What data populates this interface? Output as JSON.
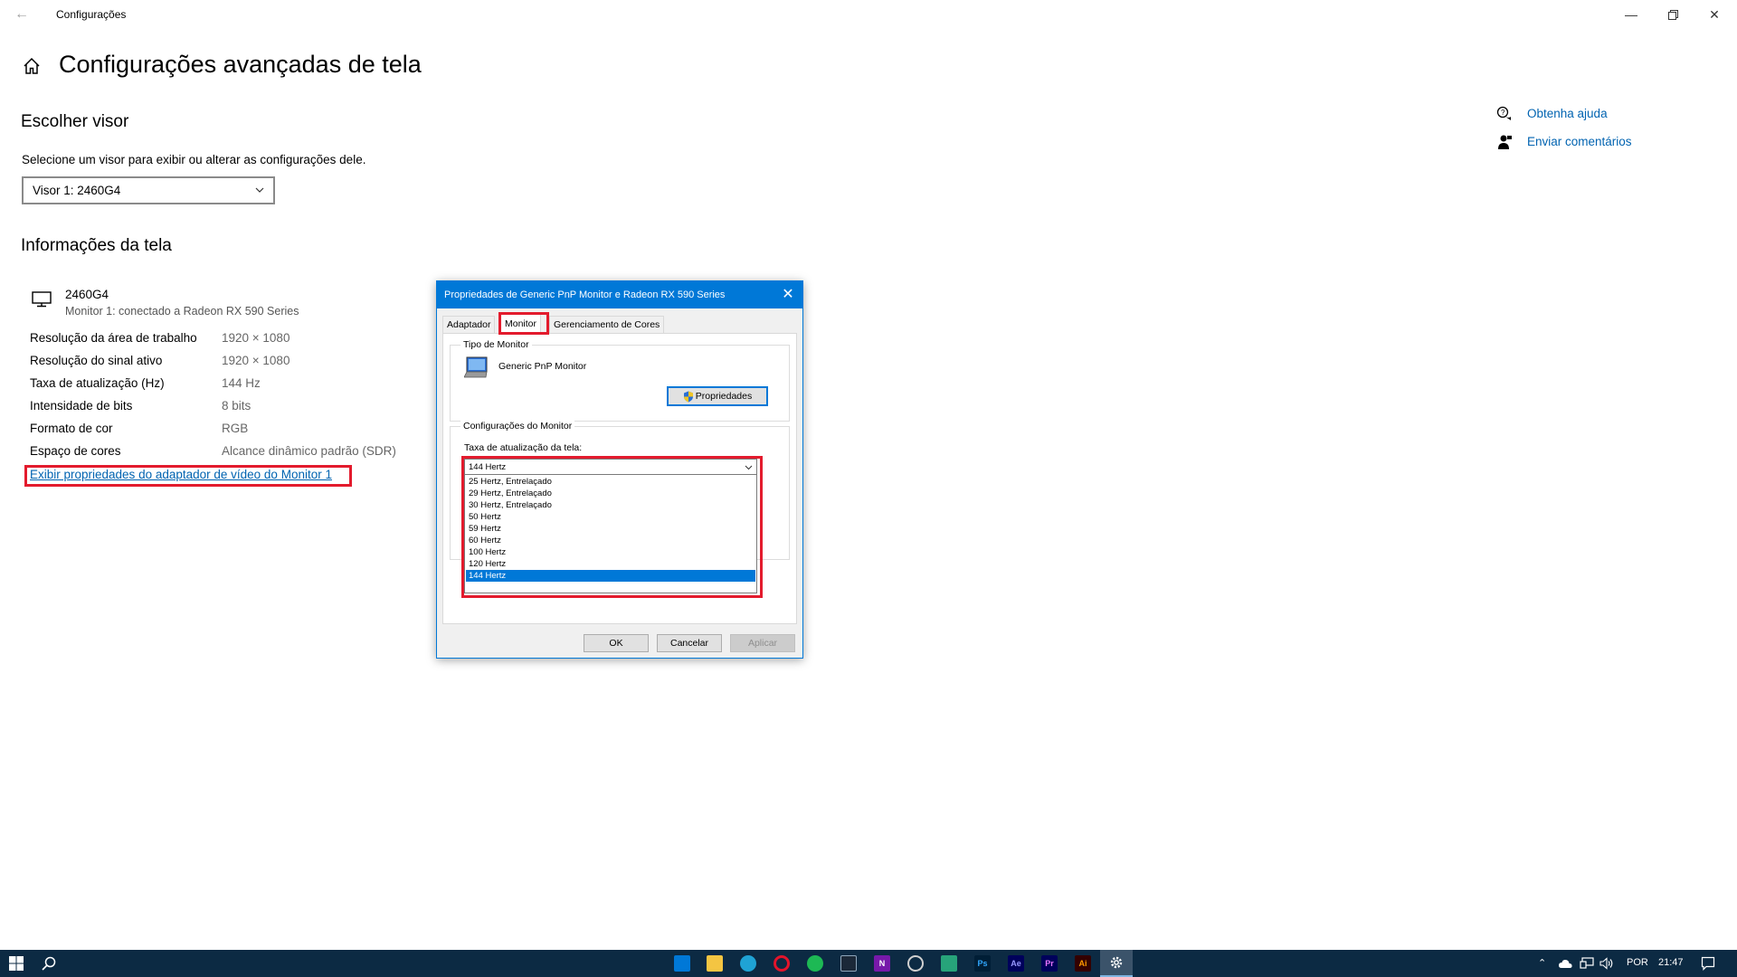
{
  "window": {
    "app_title": "Configurações",
    "page_title": "Configurações avançadas de tela"
  },
  "choose_display": {
    "title": "Escolher visor",
    "description": "Selecione um visor para exibir ou alterar as configurações dele.",
    "selected": "Visor 1: 2460G4"
  },
  "display_info": {
    "title": "Informações da tela",
    "monitor_name": "2460G4",
    "monitor_subtitle": "Monitor 1: conectado a Radeon RX 590 Series",
    "rows": [
      {
        "label": "Resolução da área de trabalho",
        "value": "1920 × 1080"
      },
      {
        "label": "Resolução do sinal ativo",
        "value": "1920 × 1080"
      },
      {
        "label": "Taxa de atualização (Hz)",
        "value": "144 Hz"
      },
      {
        "label": "Intensidade de bits",
        "value": "8 bits"
      },
      {
        "label": "Formato de cor",
        "value": "RGB"
      },
      {
        "label": "Espaço de cores",
        "value": "Alcance dinâmico padrão (SDR)"
      }
    ],
    "adapter_link": "Exibir propriedades do adaptador de vídeo do Monitor 1"
  },
  "side_links": {
    "help": "Obtenha ajuda",
    "feedback": "Enviar comentários"
  },
  "dialog": {
    "title": "Propriedades de Generic PnP Monitor e Radeon RX 590 Series",
    "tabs": [
      "Adaptador",
      "Monitor",
      "Gerenciamento de Cores"
    ],
    "active_tab": "Monitor",
    "monitor_type_group": "Tipo de Monitor",
    "monitor_type_name": "Generic PnP Monitor",
    "properties_button": "Propriedades",
    "monitor_settings_group": "Configurações do Monitor",
    "refresh_label": "Taxa de atualização da tela:",
    "refresh_selected": "144 Hertz",
    "refresh_options": [
      "25 Hertz, Entrelaçado",
      "29 Hertz, Entrelaçado",
      "30 Hertz, Entrelaçado",
      "50 Hertz",
      "59 Hertz",
      "60 Hertz",
      "100 Hertz",
      "120 Hertz",
      "144 Hertz"
    ],
    "buttons": {
      "ok": "OK",
      "cancel": "Cancelar",
      "apply": "Aplicar"
    }
  },
  "taskbar": {
    "apps": [
      "store",
      "file-explorer",
      "edge",
      "opera",
      "spotify",
      "steam",
      "onenote",
      "clock-app",
      "greenshot",
      "photoshop",
      "after-effects",
      "premiere",
      "illustrator",
      "settings"
    ],
    "language": "POR",
    "time": "21:47"
  },
  "colors": {
    "accent": "#0078d7",
    "link": "#0063b1",
    "highlight_box": "#e31b2d",
    "taskbar": "#0c2a43"
  }
}
